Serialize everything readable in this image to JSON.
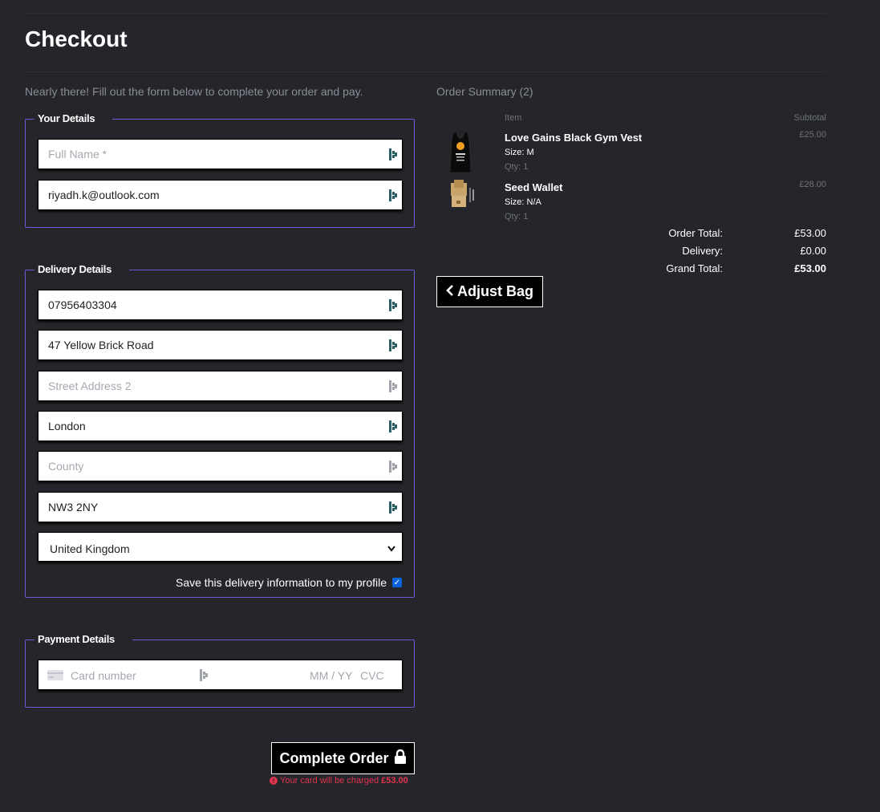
{
  "page": {
    "title": "Checkout",
    "intro": "Nearly there! Fill out the form below to complete your order and pay."
  },
  "your_details": {
    "legend": "Your Details",
    "full_name_placeholder": "Full Name *",
    "email_value": "riyadh.k@outlook.com"
  },
  "delivery": {
    "legend": "Delivery Details",
    "phone_value": "07956403304",
    "street1_value": "47 Yellow Brick Road",
    "street2_placeholder": "Street Address 2",
    "town_value": "London",
    "county_placeholder": "County",
    "postcode_value": "NW3 2NY",
    "country_selected": "United Kingdom",
    "save_label": "Save this delivery information to my profile",
    "save_checked": true
  },
  "payment": {
    "legend": "Payment Details",
    "card_placeholder": "Card number",
    "expiry_placeholder": "MM / YY",
    "cvc_placeholder": "CVC"
  },
  "actions": {
    "complete_label": "Complete Order",
    "charge_text": "Your card will be charged",
    "charge_amount": "£53.00",
    "adjust_label": "Adjust Bag"
  },
  "summary": {
    "title": "Order Summary (2)",
    "col_item": "Item",
    "col_subtotal": "Subtotal",
    "items": [
      {
        "name": "Love Gains Black Gym Vest",
        "size": "Size: M",
        "qty": "Qty: 1",
        "price": "£25.00"
      },
      {
        "name": "Seed Wallet",
        "size": "Size: N/A",
        "qty": "Qty: 1",
        "price": "£28.00"
      }
    ],
    "order_total_label": "Order Total:",
    "order_total": "£53.00",
    "delivery_label": "Delivery:",
    "delivery": "£0.00",
    "grand_total_label": "Grand Total:",
    "grand_total": "£53.00"
  },
  "colors": {
    "background": "#25262b",
    "fieldset_border": "#6b5cd6",
    "error": "#e0344d",
    "checkbox": "#0b64dd"
  }
}
